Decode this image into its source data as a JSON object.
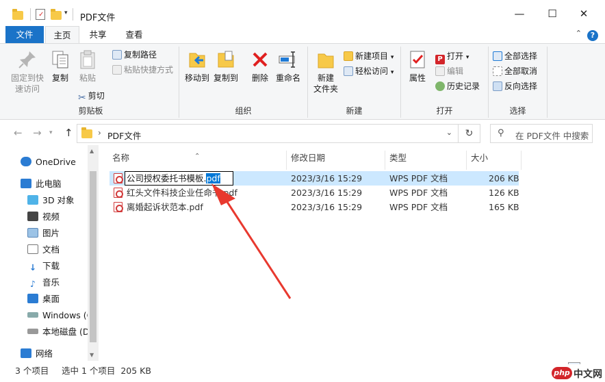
{
  "window": {
    "title": "PDF文件",
    "minimize": "—",
    "maximize": "☐",
    "close": "✕"
  },
  "tabs": [
    {
      "label": "文件"
    },
    {
      "label": "主页"
    },
    {
      "label": "共享"
    },
    {
      "label": "查看"
    }
  ],
  "ribbon": {
    "clipboard": {
      "label": "剪贴板",
      "pin": "固定到快\n速访问",
      "copy": "复制",
      "paste": "粘贴",
      "copy_path": "复制路径",
      "paste_shortcut": "粘贴快捷方式",
      "cut": "剪切"
    },
    "organize": {
      "label": "组织",
      "move_to": "移动到",
      "copy_to": "复制到",
      "delete": "删除",
      "rename": "重命名"
    },
    "new": {
      "label": "新建",
      "new_folder": "新建\n文件夹",
      "new_item": "新建项目",
      "easy_access": "轻松访问"
    },
    "open": {
      "label": "打开",
      "properties": "属性",
      "open": "打开",
      "edit": "编辑",
      "history": "历史记录"
    },
    "select": {
      "label": "选择",
      "select_all": "全部选择",
      "select_none": "全部取消",
      "invert": "反向选择"
    }
  },
  "address": {
    "path": "PDF文件",
    "search_placeholder": "在 PDF文件 中搜索"
  },
  "nav": {
    "items": [
      {
        "label": "OneDrive",
        "icon": "cloud-icon"
      },
      {
        "label": "此电脑",
        "icon": "computer-icon"
      },
      {
        "label": "3D 对象",
        "icon": "cube-icon"
      },
      {
        "label": "视频",
        "icon": "video-icon"
      },
      {
        "label": "图片",
        "icon": "picture-icon"
      },
      {
        "label": "文档",
        "icon": "document-icon"
      },
      {
        "label": "下载",
        "icon": "download-icon"
      },
      {
        "label": "音乐",
        "icon": "music-icon"
      },
      {
        "label": "桌面",
        "icon": "desktop-icon"
      },
      {
        "label": "Windows (C",
        "icon": "drive-icon"
      },
      {
        "label": "本地磁盘 (D",
        "icon": "drive-icon"
      },
      {
        "label": "网络",
        "icon": "network-icon"
      }
    ]
  },
  "columns": {
    "name": "名称",
    "modified": "修改日期",
    "type": "类型",
    "size": "大小"
  },
  "files": [
    {
      "name_base": "公司授权委托书模板.",
      "name_ext": "pdf",
      "modified": "2023/3/16 15:29",
      "type": "WPS PDF 文档",
      "size": "206 KB"
    },
    {
      "name": "红头文件科技企业任命书.pdf",
      "modified": "2023/3/16 15:29",
      "type": "WPS PDF 文档",
      "size": "126 KB"
    },
    {
      "name": "离婚起诉状范本.pdf",
      "modified": "2023/3/16 15:29",
      "type": "WPS PDF 文档",
      "size": "165 KB"
    }
  ],
  "status": {
    "item_count": "3 个项目",
    "selection": "选中 1 个项目  205 KB"
  },
  "watermark": {
    "logo": "php",
    "text": "中文网"
  },
  "colors": {
    "accent": "#1a73c8",
    "selected_row": "#cce8ff",
    "arrow": "#e8392f"
  }
}
